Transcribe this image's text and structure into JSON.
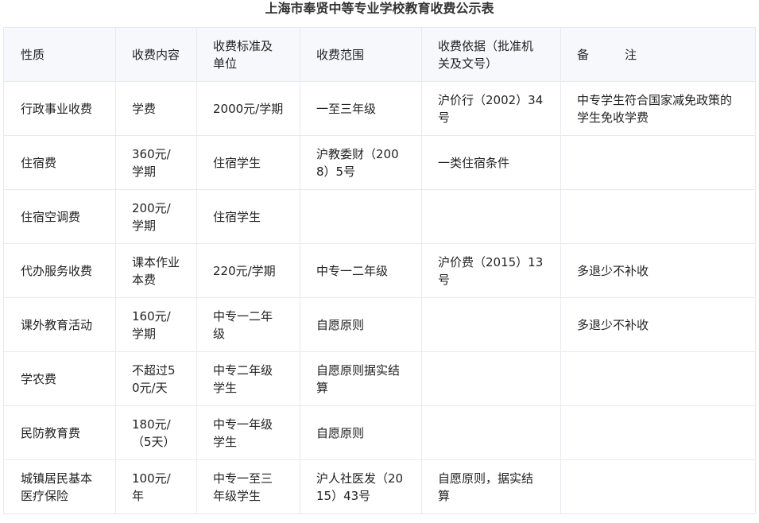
{
  "title": "上海市奉贤中等专业学校教育收费公示表",
  "table": {
    "headers": [
      "性质",
      "收费内容",
      "收费标准及单位",
      "收费范围",
      "收费依据（批准机关及文号）",
      "备　　　注"
    ],
    "rows": [
      [
        "行政事业收费",
        "学费",
        "2000元/学期",
        "一至三年级",
        "沪价行（2002）34号",
        "中专学生符合国家减免政策的学生免收学费"
      ],
      [
        "住宿费",
        "360元/学期",
        "住宿学生",
        "沪教委财（2008）5号",
        "一类住宿条件",
        ""
      ],
      [
        "住宿空调费",
        "200元/学期",
        "住宿学生",
        "",
        "",
        ""
      ],
      [
        "代办服务收费",
        "课本作业本费",
        "220元/学期",
        "中专一二年级",
        "沪价费（2015）13号",
        "多退少不补收"
      ],
      [
        "课外教育活动",
        "160元/学期",
        "中专一二年级",
        "自愿原则",
        "",
        "多退少不补收"
      ],
      [
        "学农费",
        "不超过50元/天",
        "中专二年级学生",
        "自愿原则据实结算",
        "",
        ""
      ],
      [
        "民防教育费",
        "180元/（5天）",
        "中专一年级学生",
        "自愿原则",
        "",
        ""
      ],
      [
        "城镇居民基本医疗保险",
        "100元/年",
        "中专一至三年级学生",
        "沪人社医发（2015）43号",
        "自愿原则，据实结算",
        ""
      ]
    ]
  }
}
